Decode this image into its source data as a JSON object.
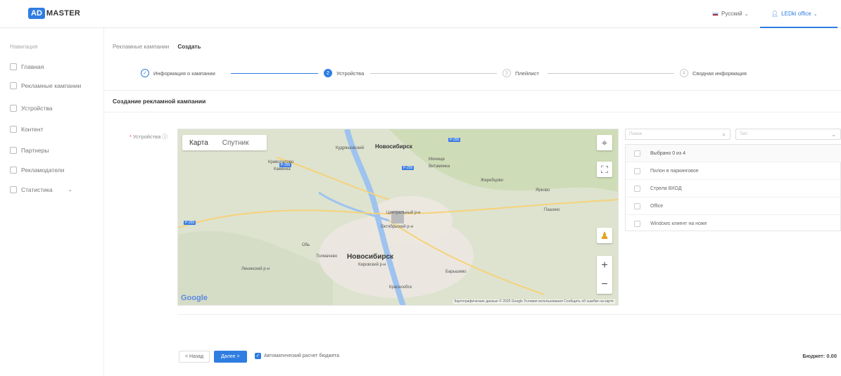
{
  "header": {
    "logo_badge": "AD",
    "logo_text": "MASTER",
    "language": "Русский",
    "user": "LEDki office"
  },
  "sidebar": {
    "title": "Навигация",
    "items": [
      {
        "label": "Главная",
        "icon": "home-icon"
      },
      {
        "label": "Рекламные кампании",
        "icon": "megaphone-icon"
      },
      {
        "label": "Устройства",
        "icon": "monitor-icon"
      },
      {
        "label": "Контент",
        "icon": "content-icon"
      },
      {
        "label": "Партнеры",
        "icon": "partners-icon"
      },
      {
        "label": "Рекламодатели",
        "icon": "advertisers-icon"
      },
      {
        "label": "Статистика",
        "icon": "chart-icon"
      }
    ]
  },
  "breadcrumb": {
    "parent": "Рекламные кампании",
    "current": "Создать"
  },
  "steps": [
    {
      "label": "Информация о кампании",
      "state": "done"
    },
    {
      "label": "Устройства",
      "state": "active",
      "number": "2"
    },
    {
      "label": "Плейлист",
      "state": "pending",
      "number": "3"
    },
    {
      "label": "Сводная информация",
      "state": "pending",
      "number": "4"
    }
  ],
  "card": {
    "title": "Создание рекламной кампании",
    "devices_label": "Устройства"
  },
  "map": {
    "tab_map": "Карта",
    "tab_satellite": "Спутник",
    "city_main": "Новосибирск",
    "city_top": "Новосибирск",
    "labels": [
      "Криволапово",
      "Кудряшовский",
      "Каменка",
      "Мочище",
      "Витаминка",
      "Жеребцово",
      "Ярково",
      "Пашино",
      "Центральный р-н",
      "Октябрьский р-н",
      "Толмачево",
      "Обь",
      "Кировский р-н",
      "Краснообск",
      "Барышево",
      "Ленинский р-н"
    ],
    "google": "Google",
    "footer": "Картографические данные © 2020 Google   Условия использования   Сообщить об ошибке на карте"
  },
  "device_list": {
    "search_placeholder": "Поиск",
    "type_placeholder": "Тип",
    "header": "Выбрано 0 из 4",
    "items": [
      "Пилон в паркинговое",
      "Стрела ВХОД",
      "Office",
      "Windows клиент на ноже"
    ]
  },
  "actions": {
    "back": "< Назад",
    "next": "Далее >",
    "auto_budget": "Автоматический расчет бюджета",
    "budget": "Бюджет: 0.00"
  }
}
